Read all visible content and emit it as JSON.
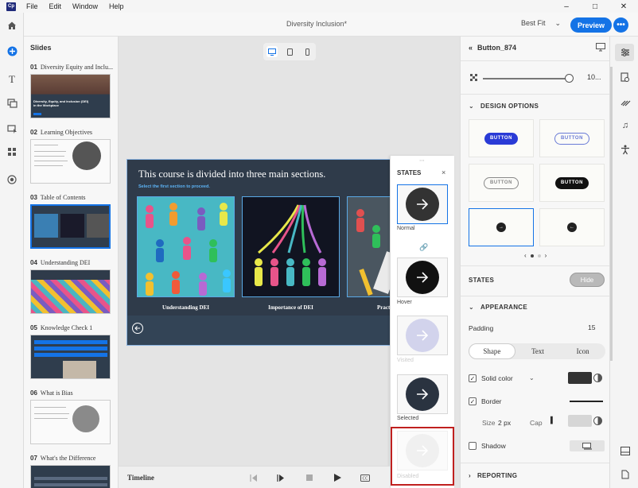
{
  "menu": {
    "app_icon": "Cp",
    "items": [
      "File",
      "Edit",
      "Window",
      "Help"
    ]
  },
  "window": {
    "minimize": "–",
    "maximize": "□",
    "close": "✕"
  },
  "toolbar": {
    "doc_title": "Diversity Inclusion*",
    "zoom": "Best Fit",
    "zoom_chevron": "⌄",
    "preview": "Preview",
    "more": "•••"
  },
  "slides": {
    "title": "Slides",
    "items": [
      {
        "num": "01",
        "name": "Diversity Equity and Inclu...",
        "thumb_text": "Diversity, Equity, and Inclusion (DEI) in the Workplace"
      },
      {
        "num": "02",
        "name": "Learning Objectives"
      },
      {
        "num": "03",
        "name": "Table of Contents"
      },
      {
        "num": "04",
        "name": "Understanding DEI"
      },
      {
        "num": "05",
        "name": "Knowledge Check 1"
      },
      {
        "num": "06",
        "name": "What is Bias"
      },
      {
        "num": "07",
        "name": "What's the Difference"
      }
    ]
  },
  "canvas": {
    "heading": "This course is divided into three main sections.",
    "subheading": "Select the first section to proceed.",
    "cards": [
      "Understanding DEI",
      "Importance of DEI",
      "Practi"
    ]
  },
  "states": {
    "title": "STATES",
    "close": "×",
    "items": [
      {
        "label": "Normal"
      },
      {
        "label": "Hover"
      },
      {
        "label": "Visited"
      },
      {
        "label": "Selected"
      },
      {
        "label": "Disabled"
      }
    ]
  },
  "timeline": {
    "label": "Timeline"
  },
  "props": {
    "object_name": "Button_874",
    "opacity_value": "10...",
    "design_options_title": "DESIGN OPTIONS",
    "tile_label": "BUTTON",
    "states_title": "STATES",
    "hide_label": "Hide",
    "appearance_title": "APPEARANCE",
    "padding_label": "Padding",
    "padding_value": "15",
    "tabs": [
      "Shape",
      "Text",
      "Icon"
    ],
    "solid_color_label": "Solid color",
    "border_label": "Border",
    "size_label": "Size",
    "size_value": "2 px",
    "cap_label": "Cap",
    "shadow_label": "Shadow",
    "reporting_title": "REPORTING"
  },
  "colors": {
    "accent": "#1473e6",
    "highlight": "#c0201f",
    "slide_bg": "#2f3b4a"
  }
}
